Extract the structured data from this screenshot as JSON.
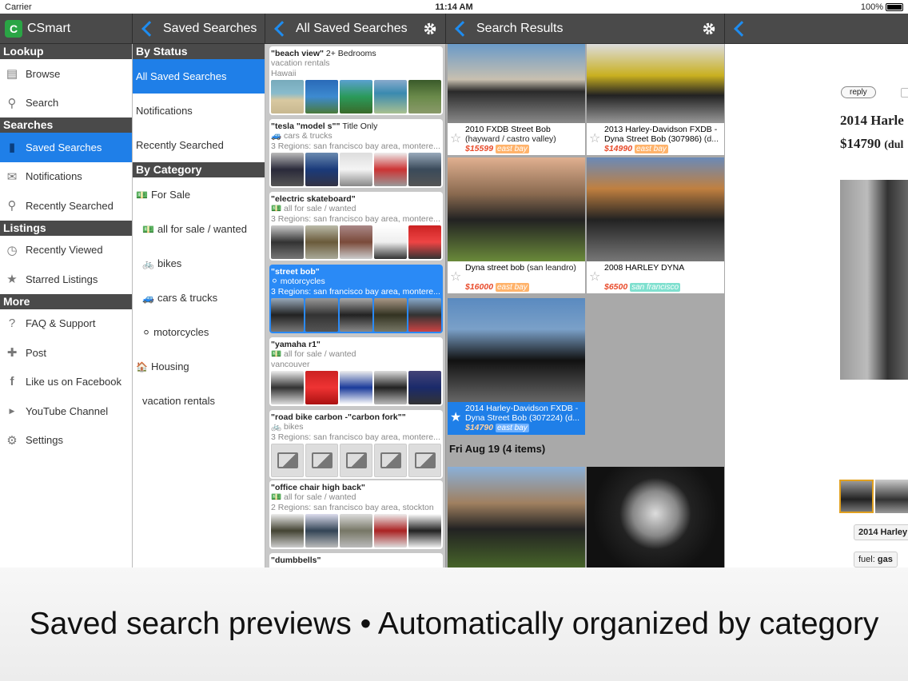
{
  "statusbar": {
    "carrier": "Carrier",
    "time": "11:14 AM",
    "battery": "100%"
  },
  "topbar": {
    "app_name": "CSmart",
    "col2_title": "Saved Searches",
    "col3_title": "All Saved Searches",
    "col4_title": "Search Results"
  },
  "sidebar": {
    "sections": [
      {
        "title": "Lookup",
        "items": [
          {
            "label": "Browse",
            "icon": "calendar-icon"
          },
          {
            "label": "Search",
            "icon": "search-icon"
          }
        ]
      },
      {
        "title": "Searches",
        "items": [
          {
            "label": "Saved Searches",
            "icon": "bookmark-icon"
          },
          {
            "label": "Notifications",
            "icon": "envelope-icon"
          },
          {
            "label": "Recently Searched",
            "icon": "search-history-icon"
          }
        ]
      },
      {
        "title": "Listings",
        "items": [
          {
            "label": "Recently Viewed",
            "icon": "clock-icon"
          },
          {
            "label": "Starred Listings",
            "icon": "star-icon"
          }
        ]
      },
      {
        "title": "More",
        "items": [
          {
            "label": "FAQ & Support",
            "icon": "question-icon"
          },
          {
            "label": "Post",
            "icon": "plus-icon"
          },
          {
            "label": "Like us on Facebook",
            "icon": "facebook-icon"
          },
          {
            "label": "YouTube Channel",
            "icon": "youtube-icon"
          },
          {
            "label": "Settings",
            "icon": "gear-icon"
          }
        ]
      }
    ]
  },
  "status_panel": {
    "by_status": "By Status",
    "status_items": [
      "All Saved Searches",
      "Notifications",
      "Recently Searched"
    ],
    "by_category": "By Category",
    "category_items": [
      "For Sale",
      "all for sale / wanted",
      "bikes",
      "cars & trucks",
      "motorcycles",
      "Housing",
      "vacation rentals"
    ]
  },
  "saved_searches": [
    {
      "query": "\"beach view\"",
      "extra": "2+ Bedrooms",
      "line2": "vacation rentals",
      "line3": "Hawaii"
    },
    {
      "query": "\"tesla \"model s\"\"",
      "extra": "Title Only",
      "line2": "cars & trucks",
      "line3": "3 Regions: san francisco bay area, montere..."
    },
    {
      "query": "\"electric skateboard\"",
      "extra": "",
      "line2": "all for sale / wanted",
      "line3": "3 Regions: san francisco bay area, montere..."
    },
    {
      "query": "\"street bob\"",
      "extra": "",
      "line2": "motorcycles",
      "line3": "3 Regions: san francisco bay area, montere..."
    },
    {
      "query": "\"yamaha r1\"",
      "extra": "",
      "line2": "all for sale / wanted",
      "line3": "vancouver"
    },
    {
      "query": "\"road bike carbon -\"carbon fork\"\"",
      "extra": "",
      "line2": "bikes",
      "line3": "3 Regions: san francisco bay area, montere..."
    },
    {
      "query": "\"office chair high back\"",
      "extra": "",
      "line2": "all for sale / wanted",
      "line3": "2 Regions: san francisco bay area, stockton"
    },
    {
      "query": "\"dumbbells\"",
      "extra": "",
      "line2": "",
      "line3": ""
    }
  ],
  "results": [
    {
      "title": "2010 FXDB Street Bob",
      "sub": "(hayward / castro valley)",
      "price": "$15599",
      "loc": "east bay"
    },
    {
      "title": "2013 Harley-Davidson FXDB - Dyna Street Bob (307986)",
      "sub": "(d...",
      "price": "$14990",
      "loc": "east bay"
    },
    {
      "title": "Dyna street bob",
      "sub": "(san leandro)",
      "price": "$16000",
      "loc": "east bay"
    },
    {
      "title": "2008 HARLEY DYNA",
      "sub": "",
      "price": "$6500",
      "loc": "san francisco"
    },
    {
      "title": "2014 Harley-Davidson FXDB - Dyna Street Bob (307224)",
      "sub": "(d...",
      "price": "$14790",
      "loc": "east bay"
    }
  ],
  "date_header": "Fri Aug 19 (4 items)",
  "detail": {
    "reply": "reply",
    "title": "2014 Harle",
    "price": "$14790",
    "price_suffix": "(dul",
    "thumb_caption": "2014 Harley",
    "attr_label": "fuel:",
    "attr_value": "gas"
  },
  "overlay_caption": "Saved search previews • Automatically organized by category",
  "colors": {
    "accent": "#1f7fe8",
    "bar": "#4a4a4a",
    "price": "#e84a2a"
  }
}
